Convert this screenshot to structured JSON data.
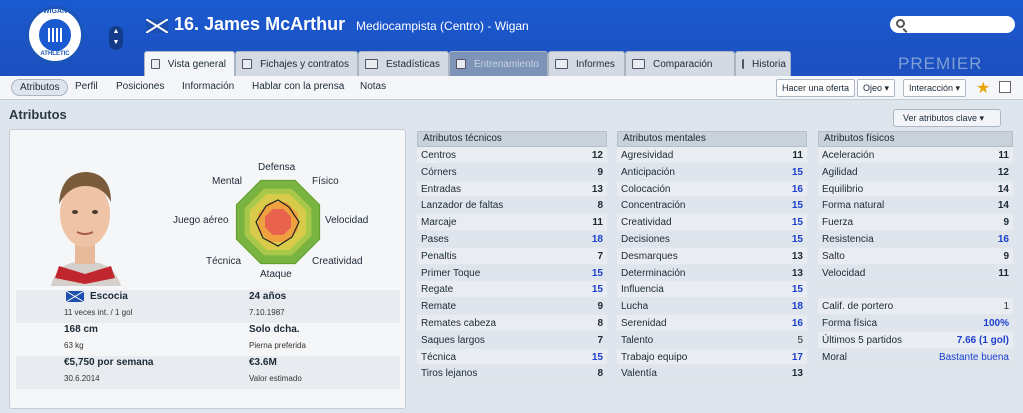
{
  "header": {
    "crest_top": "WIGAN",
    "crest_bottom": "ATHLETIC",
    "name": "16. James McArthur",
    "subtitle": "Mediocampista (Centro) - Wigan",
    "watermark": "PREMIER"
  },
  "tabs": [
    {
      "label": "Vista general"
    },
    {
      "label": "Fichajes y contratos"
    },
    {
      "label": "Estadísticas"
    },
    {
      "label": "Entrenamiento"
    },
    {
      "label": "Informes"
    },
    {
      "label": "Comparación"
    },
    {
      "label": "Historia"
    }
  ],
  "subnav": {
    "items": [
      "Atributos",
      "Perfil",
      "Posiciones",
      "Información",
      "Hablar con la prensa",
      "Notas"
    ],
    "offer": "Hacer una oferta",
    "scout": "Ojeo",
    "interact": "Interacción"
  },
  "page": {
    "title": "Atributos",
    "key_button": "Ver atributos clave"
  },
  "radar": {
    "labels": {
      "top": "Defensa",
      "top_right": "Físico",
      "right": "Velocidad",
      "bottom_right": "Creatividad",
      "bottom": "Ataque",
      "bottom_left": "Técnica",
      "left": "Juego aéreo",
      "top_left": "Mental"
    }
  },
  "info": {
    "nation": "Escocia",
    "caps": "11 veces int. / 1 gol",
    "age": "24 años",
    "dob": "7.10.1987",
    "height": "168 cm",
    "foot": "Solo dcha.",
    "weight": "63 kg",
    "foot_label": "Pierna preferida",
    "wage": "€5,750 por semana",
    "value": "€3.6M",
    "contract": "30.6.2014",
    "value_label": "Valor estimado"
  },
  "technical": {
    "title": "Atributos técnicos",
    "rows": [
      {
        "name": "Centros",
        "value": "12"
      },
      {
        "name": "Córners",
        "value": "9"
      },
      {
        "name": "Entradas",
        "value": "13"
      },
      {
        "name": "Lanzador de faltas",
        "value": "8"
      },
      {
        "name": "Marcaje",
        "value": "11"
      },
      {
        "name": "Pases",
        "value": "18"
      },
      {
        "name": "Penaltis",
        "value": "7"
      },
      {
        "name": "Primer Toque",
        "value": "15"
      },
      {
        "name": "Regate",
        "value": "15"
      },
      {
        "name": "Remate",
        "value": "9"
      },
      {
        "name": "Remates cabeza",
        "value": "8"
      },
      {
        "name": "Saques largos",
        "value": "7"
      },
      {
        "name": "Técnica",
        "value": "15"
      },
      {
        "name": "Tiros lejanos",
        "value": "8"
      }
    ]
  },
  "mental": {
    "title": "Atributos mentales",
    "rows": [
      {
        "name": "Agresividad",
        "value": "11"
      },
      {
        "name": "Anticipación",
        "value": "15"
      },
      {
        "name": "Colocación",
        "value": "16"
      },
      {
        "name": "Concentración",
        "value": "15"
      },
      {
        "name": "Creatividad",
        "value": "15"
      },
      {
        "name": "Decisiones",
        "value": "15"
      },
      {
        "name": "Desmarques",
        "value": "13"
      },
      {
        "name": "Determinación",
        "value": "13"
      },
      {
        "name": "Influencia",
        "value": "15"
      },
      {
        "name": "Lucha",
        "value": "18"
      },
      {
        "name": "Serenidad",
        "value": "16"
      },
      {
        "name": "Talento",
        "value": "5"
      },
      {
        "name": "Trabajo equipo",
        "value": "17"
      },
      {
        "name": "Valentía",
        "value": "13"
      }
    ]
  },
  "physical": {
    "title": "Atributos físicos",
    "rows": [
      {
        "name": "Aceleración",
        "value": "11"
      },
      {
        "name": "Agilidad",
        "value": "12"
      },
      {
        "name": "Equilibrio",
        "value": "14"
      },
      {
        "name": "Forma natural",
        "value": "14"
      },
      {
        "name": "Fuerza",
        "value": "9"
      },
      {
        "name": "Resistencia",
        "value": "16"
      },
      {
        "name": "Salto",
        "value": "9"
      },
      {
        "name": "Velocidad",
        "value": "11"
      }
    ],
    "extra": [
      {
        "name": "Calif. de portero",
        "value": "1"
      },
      {
        "name": "Forma física",
        "value": "100%"
      },
      {
        "name": "Últimos 5 partidos",
        "value": "7.66 (1 gol)"
      },
      {
        "name": "Moral",
        "value": "Bastante buena"
      }
    ]
  }
}
